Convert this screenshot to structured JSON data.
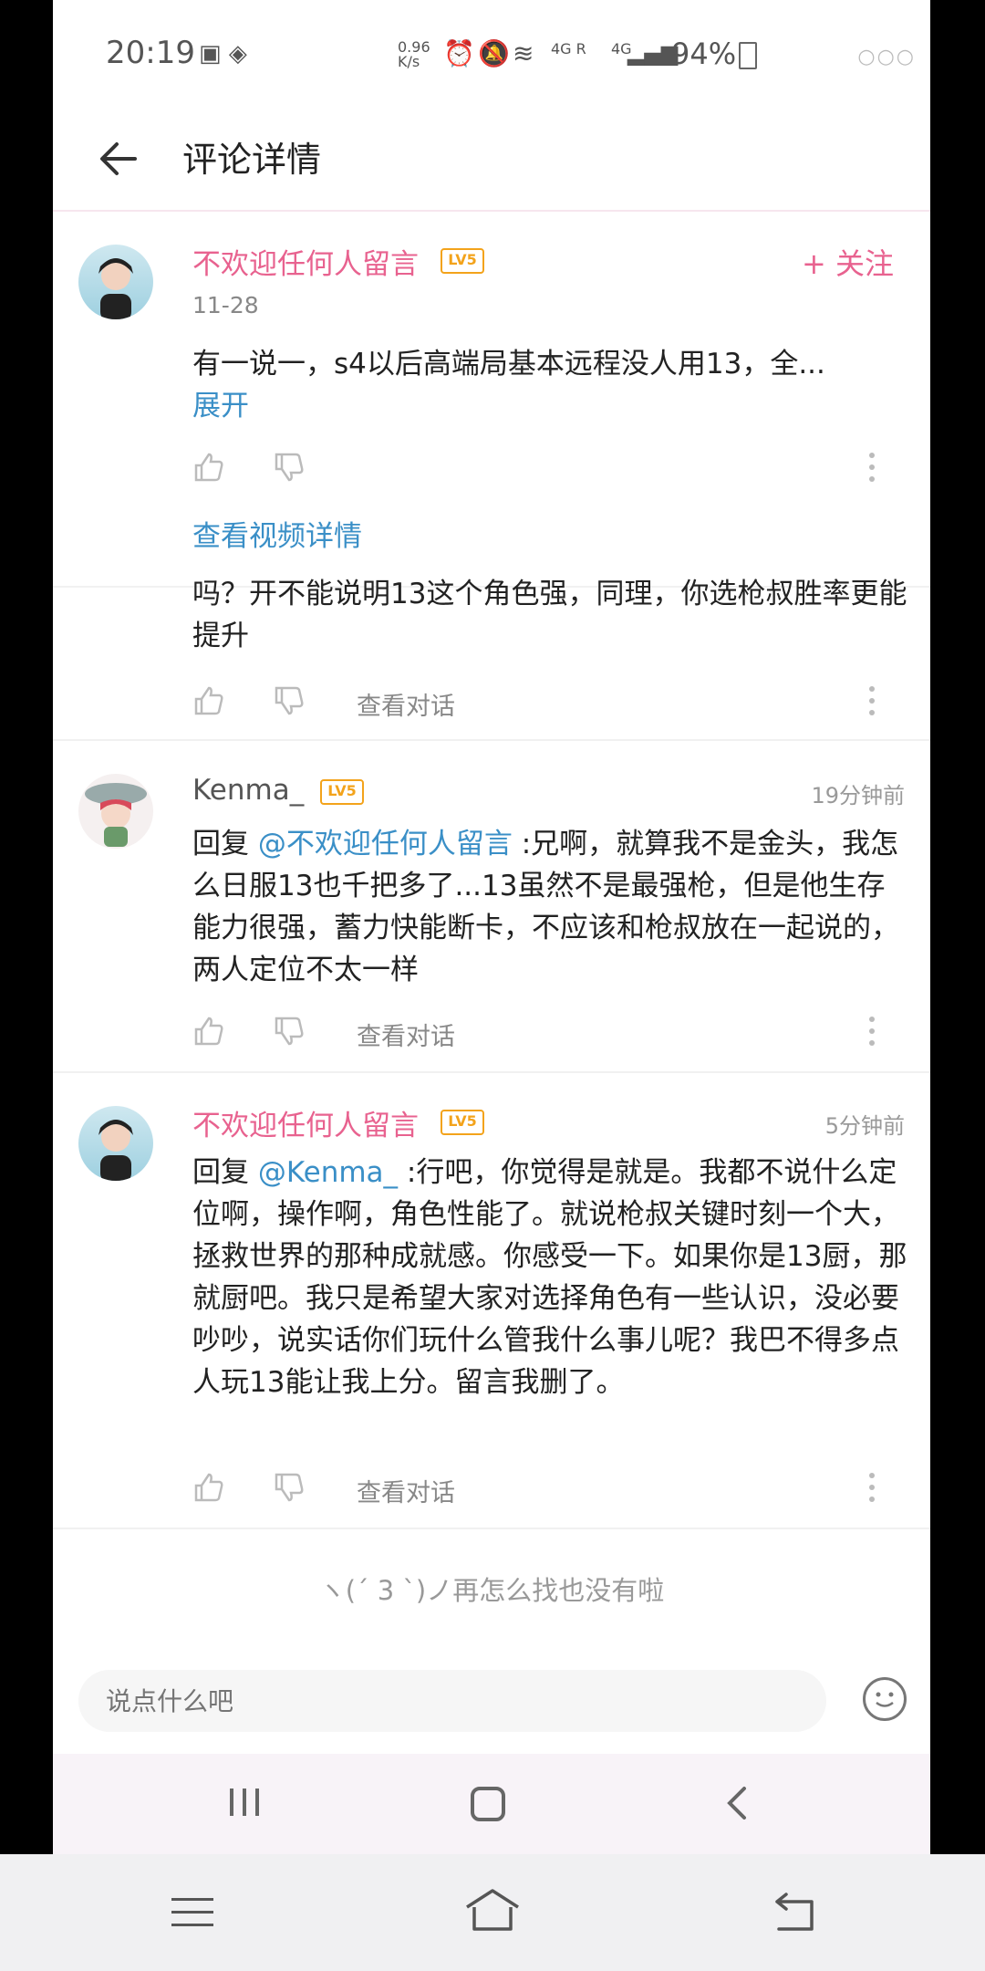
{
  "status": {
    "time": "20:19",
    "speed": "0.96 K/s",
    "net1": "4G R",
    "net2": "4G",
    "battery": "94%"
  },
  "header": {
    "title": "评论详情"
  },
  "main_comment": {
    "user": "不欢迎任何人留言",
    "level": "LV5",
    "date": "11-28",
    "follow": "+ 关注",
    "text": "有一说一，s4以后高端局基本远程没人用13，全...",
    "expand": "展开",
    "video_link": "查看视频详情"
  },
  "partial_reply": {
    "text": "吗？开不能说明13这个角色强，同理，你选枪叔胜率更能提升",
    "view_conv": "查看对话"
  },
  "replies": [
    {
      "user": "Kenma_",
      "level": "LV5",
      "time": "19分钟前",
      "prefix": "回复 ",
      "mention": "@不欢迎任何人留言",
      "text": " :兄啊，就算我不是金头，我怎么日服13也千把多了...13虽然不是最强枪，但是他生存能力很强，蓄力快能断卡，不应该和枪叔放在一起说的，两人定位不太一样",
      "view_conv": "查看对话"
    },
    {
      "user": "不欢迎任何人留言",
      "level": "LV5",
      "time": "5分钟前",
      "prefix": "回复 ",
      "mention": "@Kenma_",
      "text": " :行吧，你觉得是就是。我都不说什么定位啊，操作啊，角色性能了。就说枪叔关键时刻一个大，拯救世界的那种成就感。你感受一下。如果你是13厨，那就厨吧。我只是希望大家对选择角色有一些认识，没必要吵吵，说实话你们玩什么管我什么事儿呢？我巴不得多点人玩13能让我上分。留言我删了。",
      "view_conv": "查看对话"
    }
  ],
  "end_text": "ヽ(ˊ 3 ˋ)ノ再怎么找也没有啦",
  "input": {
    "placeholder": "说点什么吧"
  },
  "colors": {
    "accent": "#e8628f",
    "link": "#3a8fc7",
    "level": "#f3a31b"
  }
}
